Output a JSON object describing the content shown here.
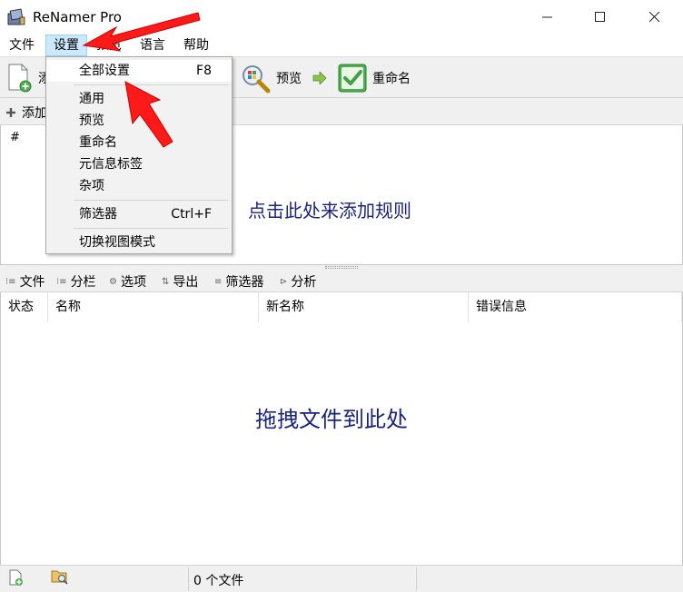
{
  "window": {
    "title": "ReNamer Pro",
    "minimize": "—",
    "maximize": "☐",
    "close": "✕"
  },
  "menubar": {
    "items": [
      "文件",
      "设置",
      "预览",
      "语言",
      "帮助"
    ]
  },
  "toolbar": {
    "add_files_label": "添",
    "preview_label": "预览",
    "rename_label": "重命名"
  },
  "rules": {
    "add_label": "添加",
    "hash_header": "#",
    "hint": "点击此处来添加规则"
  },
  "files_bar": {
    "items": [
      "文件",
      "分栏",
      "选项",
      "导出",
      "筛选器",
      "分析"
    ]
  },
  "files_table": {
    "columns": [
      "状态",
      "名称",
      "新名称",
      "错误信息"
    ],
    "hint": "拖拽文件到此处"
  },
  "statusbar": {
    "count_text": "0 个文件"
  },
  "settings_menu": {
    "items": [
      {
        "label": "全部设置",
        "shortcut": "F8"
      },
      {
        "label": "通用",
        "shortcut": ""
      },
      {
        "label": "预览",
        "shortcut": ""
      },
      {
        "label": "重命名",
        "shortcut": ""
      },
      {
        "label": "元信息标签",
        "shortcut": ""
      },
      {
        "label": "杂项",
        "shortcut": ""
      },
      {
        "label": "筛选器",
        "shortcut": "Ctrl+F"
      },
      {
        "label": "切换视图模式",
        "shortcut": ""
      }
    ]
  },
  "colors": {
    "hint_text": "#1a237e",
    "menu_active": "#cce8ff",
    "annotation_arrow": "#ff1a1a",
    "check_green": "#4caf50"
  }
}
